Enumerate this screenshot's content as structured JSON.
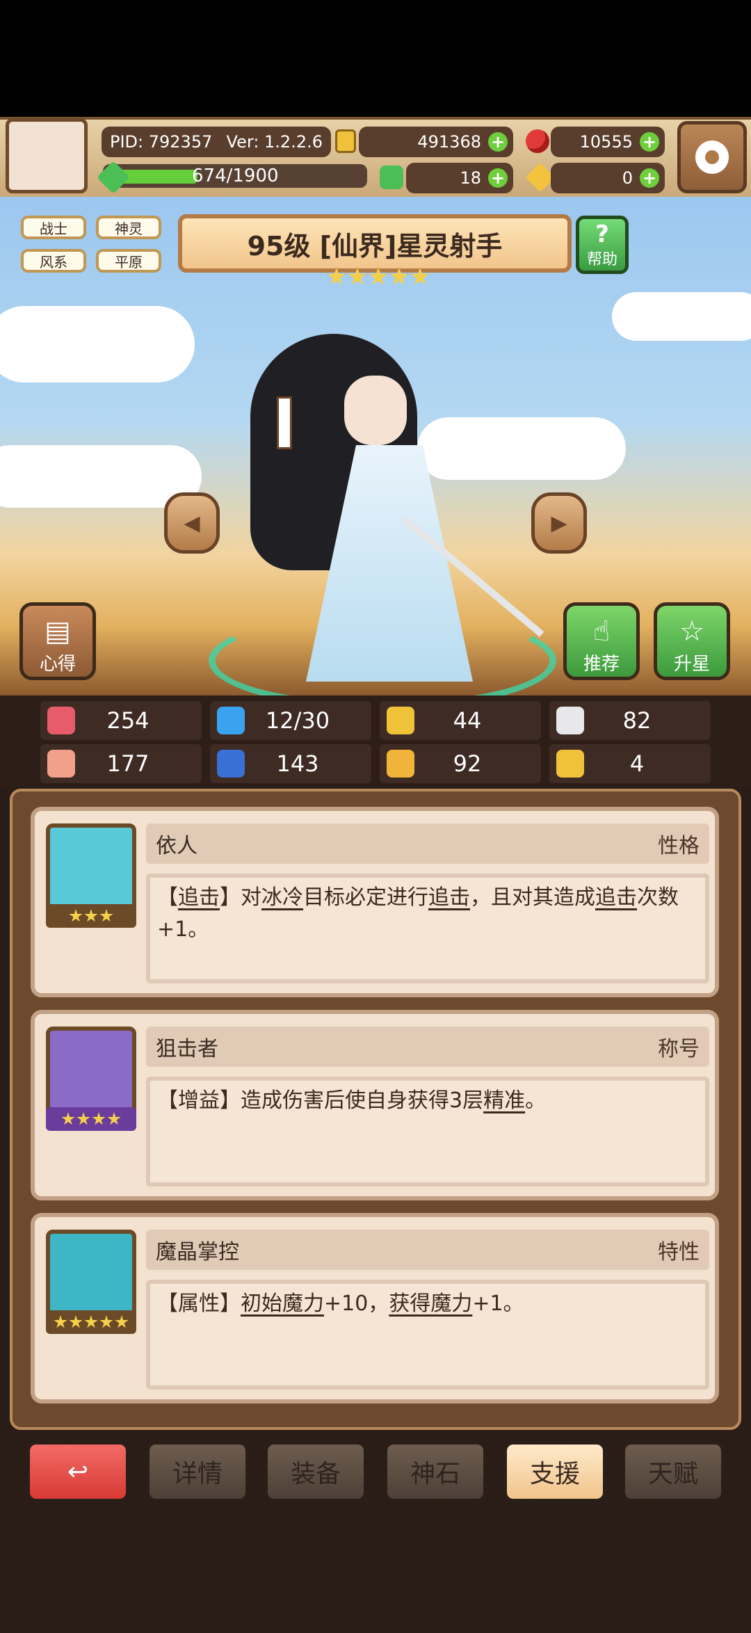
{
  "header": {
    "pid": "PID: 792357",
    "version": "Ver: 1.2.2.6",
    "gold": "491368",
    "gems": "10555",
    "exp": "674/1900",
    "clover": "18",
    "keys": "0"
  },
  "tags": [
    "战士",
    "神灵",
    "风系",
    "平原"
  ],
  "hero": {
    "title": "95级 [仙界]星灵射手",
    "stars": 5
  },
  "buttons": {
    "help": "帮助",
    "tips": "心得",
    "recommend": "推荐",
    "upgrade_star": "升星"
  },
  "stats": [
    {
      "icon": "heart-icon",
      "value": "254",
      "color": "#e85b6a"
    },
    {
      "icon": "water-drop-icon",
      "value": "12/30",
      "color": "#3aa3f0"
    },
    {
      "icon": "shield-icon",
      "value": "44",
      "color": "#f0c23a"
    },
    {
      "icon": "wing-icon",
      "value": "82",
      "color": "#e8e8ea"
    },
    {
      "icon": "fist-icon",
      "value": "177",
      "color": "#f3a08a"
    },
    {
      "icon": "book-icon",
      "value": "143",
      "color": "#3a6fd6"
    },
    {
      "icon": "boot-icon",
      "value": "92",
      "color": "#f0b43a"
    },
    {
      "icon": "horseshoe-icon",
      "value": "4",
      "color": "#f0c23a"
    }
  ],
  "cards": [
    {
      "name": "依人",
      "type": "性格",
      "stars": 3,
      "portrait_color": "#58c9d6",
      "desc_parts": [
        "【",
        "追击",
        "】对",
        "冰冷",
        "目标必定进行",
        "追击",
        "，且对其造成",
        "追击",
        "次数+1。"
      ]
    },
    {
      "name": "狙击者",
      "type": "称号",
      "stars": 4,
      "portrait_color": "#8a6bc8",
      "desc_parts": [
        "【增益】造成伤害后使自身获得3层",
        "精准",
        "。"
      ]
    },
    {
      "name": "魔晶掌控",
      "type": "特性",
      "stars": 5,
      "portrait_color": "#3fb6c6",
      "desc_parts": [
        "【属性】",
        "初始魔力",
        "+10，",
        "获得魔力",
        "+1。"
      ]
    }
  ],
  "nav": {
    "back": "↩",
    "details": "详情",
    "equipment": "装备",
    "god_stone": "神石",
    "support": "支援",
    "talent": "天赋"
  }
}
